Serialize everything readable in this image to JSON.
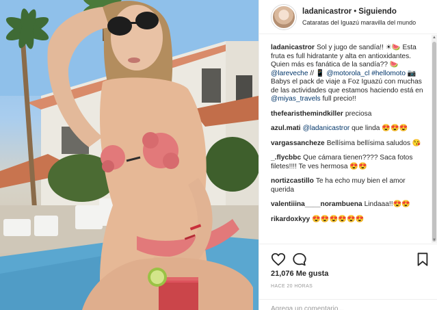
{
  "header": {
    "username": "ladanicastror",
    "separator": "•",
    "follow_status": "Siguiendo",
    "location": "Cataratas del Iguazú maravilla del mundo"
  },
  "caption": {
    "user": "ladanicastror",
    "text_1": "Sol y jugo de sandía!! ☀🍉 Esta fruta es full hidratante y alta en antioxidantes. Quien más es fanática de la sandía?? 🍉 ",
    "mention_1": "@lareveche",
    "text_2": " // 📱 ",
    "mention_2": "@motorola_cl",
    "text_3": " ",
    "hashtag": "#hellomoto",
    "text_4": " 📷Babys el pack de viaje a Foz Iguazú con muchas de las actividades que estamos haciendo está en ",
    "mention_3": "@miyas_travels",
    "text_5": " full precio!!"
  },
  "comments": [
    {
      "user": "thefearisthemindkiller",
      "mention": "",
      "text": "preciosa"
    },
    {
      "user": "azul.mati",
      "mention": "@ladanicastror",
      "text": " que linda 😍😍😍"
    },
    {
      "user": "vargassancheze",
      "mention": "",
      "text": "Bellísima bellísima saludos 😘"
    },
    {
      "user": "_.flycbbc",
      "mention": "",
      "text": "Que cámara tienen???? Saca fotos filetes!!!! Te ves hermosa 😍😍"
    },
    {
      "user": "nortizcastillo",
      "mention": "",
      "text": "Te ha echo muy bien el amor querida"
    },
    {
      "user": "valentiiina____norambuena",
      "mention": "",
      "text": "Lindaaa!!😍😍"
    },
    {
      "user": "rikardoxkyy",
      "mention": "",
      "text": "😍😍😍😍😍😍"
    }
  ],
  "stats": {
    "likes": "21,076 Me gusta",
    "time": "HACE 20 HORAS"
  },
  "add_comment": {
    "placeholder": "Agrega un comentario..."
  },
  "icons": {
    "like": "heart-icon",
    "comment": "comment-icon",
    "save": "bookmark-icon"
  },
  "colors": {
    "link": "#003569",
    "muted": "#999999",
    "text": "#262626",
    "border": "#efefef"
  }
}
